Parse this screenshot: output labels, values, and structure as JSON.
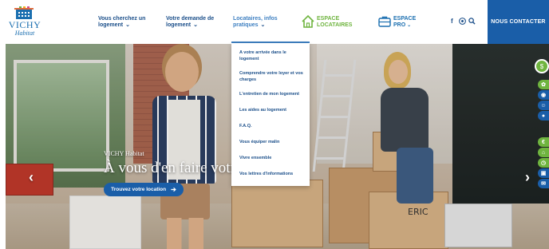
{
  "brand": {
    "name": "VICHY",
    "tagline": "Habitat"
  },
  "nav": {
    "items": [
      {
        "label": "Vous cherchez un logement"
      },
      {
        "label": "Votre demande de logement"
      },
      {
        "label": "Locataires, infos pratiques"
      }
    ],
    "espace_locataires": "ESPACE LOCATAIRES",
    "espace_pro": "ESPACE PRO",
    "contact": "NOUS CONTACTER",
    "social": {
      "facebook": "f"
    }
  },
  "dropdown": {
    "items": [
      "A votre arrivée dans le logement",
      "Comprendre votre loyer et vos charges",
      "L'entretien de mon logement",
      "Les aides au logement",
      "F.A.Q.",
      "Vous équiper malin",
      "Vivre ensemble",
      "Vos lettres d'informations"
    ]
  },
  "hero": {
    "kicker": "VICHY Habitat",
    "title": "À vous d'en faire votre l",
    "cta": "Trouvez votre location",
    "box_label": "ERIC"
  },
  "colors": {
    "brand_blue": "#1a5ea8",
    "green": "#6fb43f",
    "nav_text": "#1b4f8a"
  },
  "icons": {
    "espace_locataires": "house-icon",
    "espace_pro": "briefcase-icon",
    "search": "search-icon",
    "accessibility": "accessibility-icon"
  }
}
